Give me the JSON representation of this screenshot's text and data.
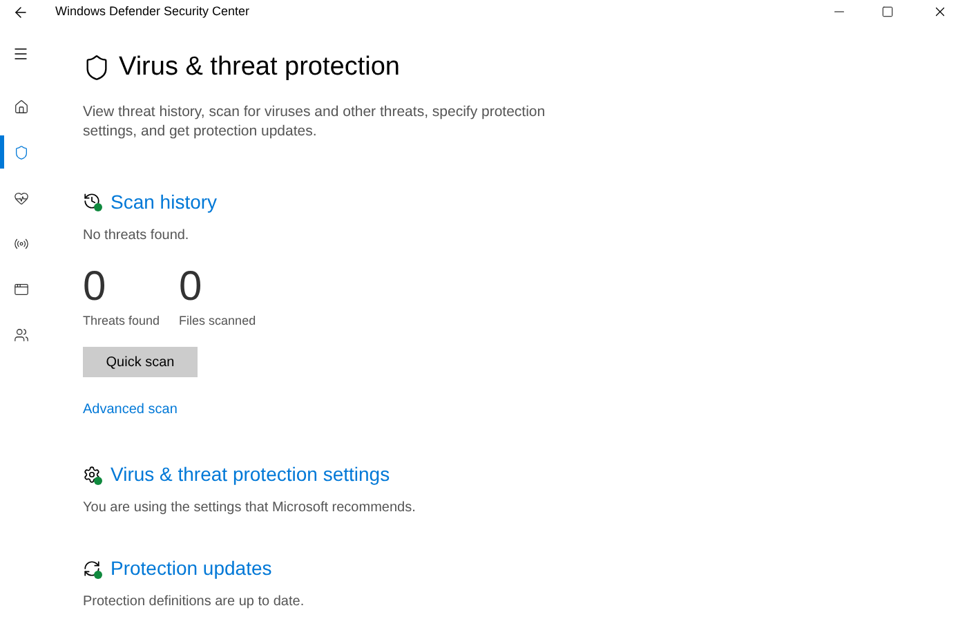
{
  "window": {
    "title": "Windows Defender Security Center"
  },
  "sidebar": {
    "items": [
      {
        "kind": "home",
        "selected": false
      },
      {
        "kind": "shield",
        "selected": true
      },
      {
        "kind": "health",
        "selected": false
      },
      {
        "kind": "network",
        "selected": false
      },
      {
        "kind": "app",
        "selected": false
      },
      {
        "kind": "family",
        "selected": false
      }
    ]
  },
  "page": {
    "title": "Virus & threat protection",
    "description": "View threat history, scan for viruses and other threats, specify protection settings, and get protection updates."
  },
  "sections": [
    {
      "kind": "history",
      "title": "Scan history",
      "subtitle": "No threats found.",
      "stats": [
        {
          "value": "0",
          "label": "Threats found"
        },
        {
          "value": "0",
          "label": "Files scanned"
        }
      ],
      "button": "Quick scan",
      "link": "Advanced scan"
    },
    {
      "kind": "settings",
      "title": "Virus & threat protection settings",
      "subtitle": "You are using the settings that Microsoft recommends."
    },
    {
      "kind": "updates",
      "title": "Protection updates",
      "subtitle": "Protection definitions are up to date."
    }
  ]
}
